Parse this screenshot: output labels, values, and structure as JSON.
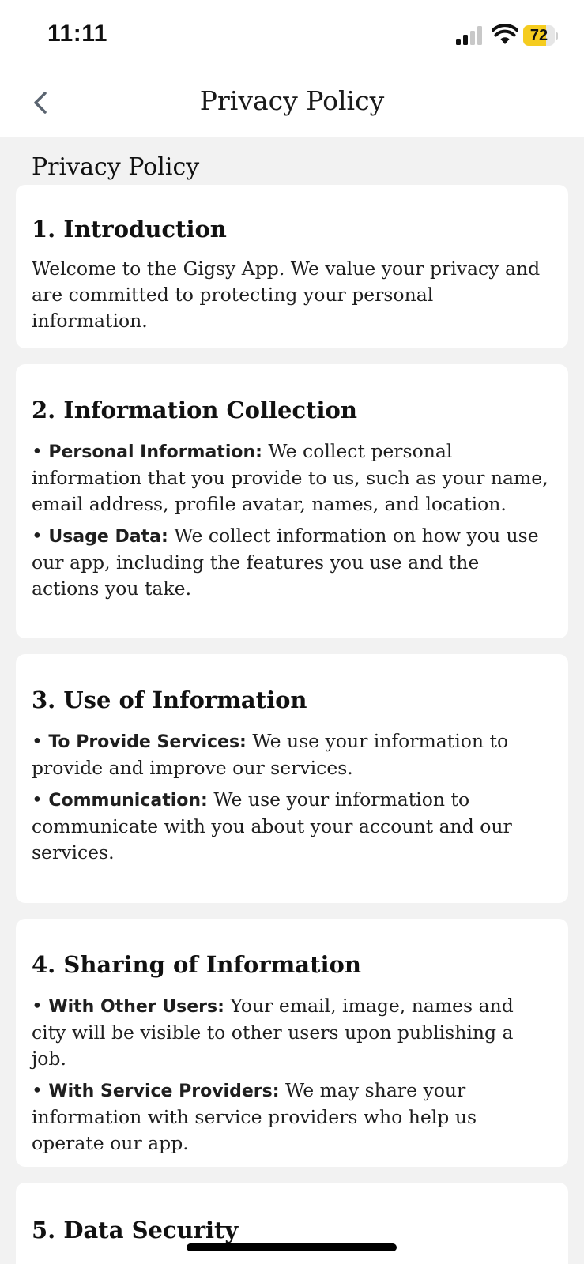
{
  "status_bar": {
    "time": "11:11",
    "battery_percent": 72,
    "battery_label": "72",
    "battery_color": "#f5cc1f",
    "signal_bars_active": 2,
    "signal_bars_total": 4
  },
  "nav": {
    "back_icon": "chevron-left-icon",
    "title": "Privacy Policy"
  },
  "page": {
    "heading": "Privacy Policy"
  },
  "sections": [
    {
      "title": "1. Introduction",
      "text": "Welcome to the Gigsy App. We value your privacy and are committed to protecting your personal information."
    },
    {
      "title": "2. Information Collection",
      "bullets": [
        {
          "label": "Personal Information:",
          "text": " We collect personal information that you provide to us, such as your name, email address, profile avatar, names, and location."
        },
        {
          "label": "Usage Data:",
          "text": " We collect information on how you use our app, including the features you use and the actions you take."
        }
      ]
    },
    {
      "title": "3. Use of Information",
      "bullets": [
        {
          "label": "To Provide Services:",
          "text": " We use your information to provide and improve our services."
        },
        {
          "label": "Communication:",
          "text": " We use your information to communicate with you about your account and our services."
        }
      ]
    },
    {
      "title": "4. Sharing of Information",
      "bullets": [
        {
          "label": "With Other Users:",
          "text": " Your email, image, names and city will be visible to other users upon publishing a job."
        },
        {
          "label": "With Service Providers:",
          "text": " We may share your information with service providers who help us operate our app."
        }
      ]
    },
    {
      "title": "5. Data Security"
    }
  ]
}
